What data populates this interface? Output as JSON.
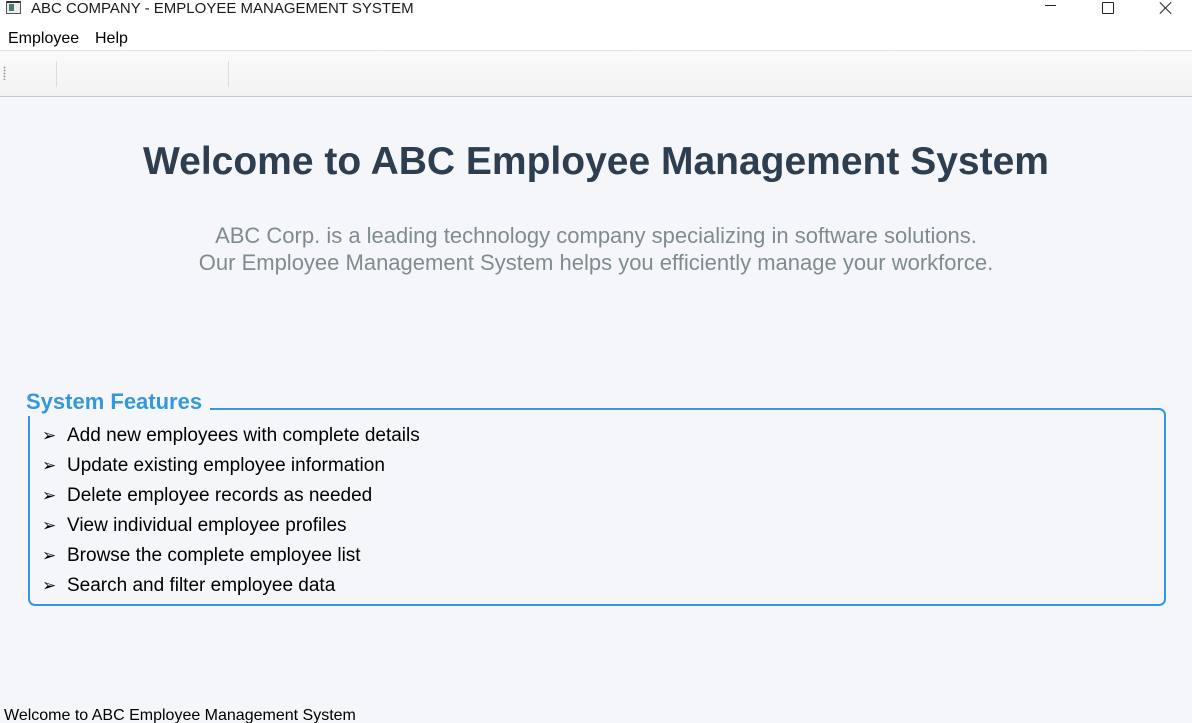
{
  "window": {
    "title": "ABC COMPANY - EMPLOYEE MANAGEMENT SYSTEM",
    "icon": "app-window-icon",
    "controls": [
      "minimize-icon",
      "maximize-icon",
      "close-icon"
    ]
  },
  "menubar": {
    "items": [
      {
        "label": "Employee"
      },
      {
        "label": "Help"
      }
    ]
  },
  "content": {
    "headline": "Welcome to ABC Employee Management System",
    "description_lines": [
      "ABC Corp. is a leading technology company specializing in software solutions.",
      "Our Employee Management System helps you efficiently manage your workforce."
    ],
    "features": {
      "title": "System Features",
      "bullet_icon": "arrow-right-icon",
      "bullet_glyph": "➢",
      "items": [
        {
          "label": "Add new employees with complete details"
        },
        {
          "label": "Update existing employee information"
        },
        {
          "label": "Delete employee records as needed"
        },
        {
          "label": "View individual employee profiles"
        },
        {
          "label": "Browse the complete employee list"
        },
        {
          "label": "Search and filter employee data"
        }
      ]
    }
  },
  "statusbar": {
    "text": "Welcome to ABC Employee Management System"
  },
  "colors": {
    "headline": "#2c3e50",
    "description": "#7f8c8d",
    "accent": "#3498db",
    "background": "#f5f6fa"
  }
}
